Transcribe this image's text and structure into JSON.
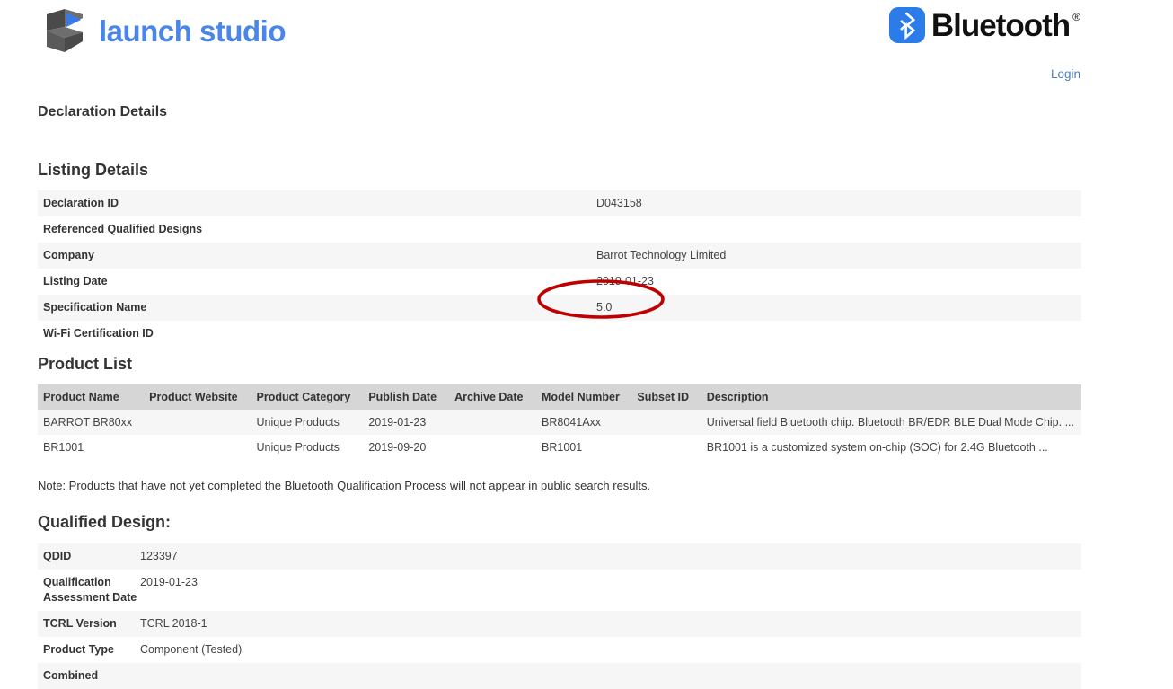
{
  "header": {
    "brand_name": "launch studio",
    "bluetooth_word": "Bluetooth",
    "registered_mark": "®",
    "login_label": "Login"
  },
  "page": {
    "title": "Declaration Details"
  },
  "listing": {
    "section_title": "Listing Details",
    "rows": [
      {
        "label": "Declaration ID",
        "value": "D043158"
      },
      {
        "label": "Referenced Qualified Designs",
        "value": ""
      },
      {
        "label": "Company",
        "value": "Barrot Technology Limited"
      },
      {
        "label": "Listing Date",
        "value": "2019-01-23"
      },
      {
        "label": "Specification Name",
        "value": "5.0"
      },
      {
        "label": "Wi-Fi Certification ID",
        "value": ""
      }
    ]
  },
  "product_list": {
    "section_title": "Product List",
    "columns": [
      "Product Name",
      "Product Website",
      "Product Category",
      "Publish Date",
      "Archive Date",
      "Model Number",
      "Subset ID",
      "Description"
    ],
    "rows": [
      {
        "product_name": "BARROT BR80xx",
        "product_website": "",
        "product_category": "Unique Products",
        "publish_date": "2019-01-23",
        "archive_date": "",
        "model_number": "BR8041Axx",
        "subset_id": "",
        "description": "Universal field Bluetooth chip. Bluetooth BR/EDR BLE Dual Mode Chip. ..."
      },
      {
        "product_name": "BR1001",
        "product_website": "",
        "product_category": "Unique Products",
        "publish_date": "2019-09-20",
        "archive_date": "",
        "model_number": "BR1001",
        "subset_id": "",
        "description": "BR1001 is a customized system on-chip (SOC) for 2.4G Bluetooth ..."
      }
    ]
  },
  "note": "Note: Products that have not yet completed the Bluetooth Qualification Process will not appear in public search results.",
  "qualified_design": {
    "section_title": "Qualified Design:",
    "rows": [
      {
        "label": "QDID",
        "value": "123397"
      },
      {
        "label": "Qualification Assessment Date",
        "value": "2019-01-23"
      },
      {
        "label": "TCRL Version",
        "value": "TCRL 2018-1"
      },
      {
        "label": "Product Type",
        "value": "Component (Tested)"
      },
      {
        "label": "Combined",
        "value": ""
      }
    ]
  },
  "annotation": {
    "shape": "ellipse",
    "color": "#C00000",
    "targets": "5.0"
  },
  "colors": {
    "brand_blue": "#4a86e8",
    "bluetooth_blue": "#2b7ce9",
    "link_blue": "#4a7ebb",
    "row_shade": "#f6f6f6",
    "header_shade": "#d6d6d6",
    "text": "#333333",
    "annotation_red": "#C00000"
  }
}
